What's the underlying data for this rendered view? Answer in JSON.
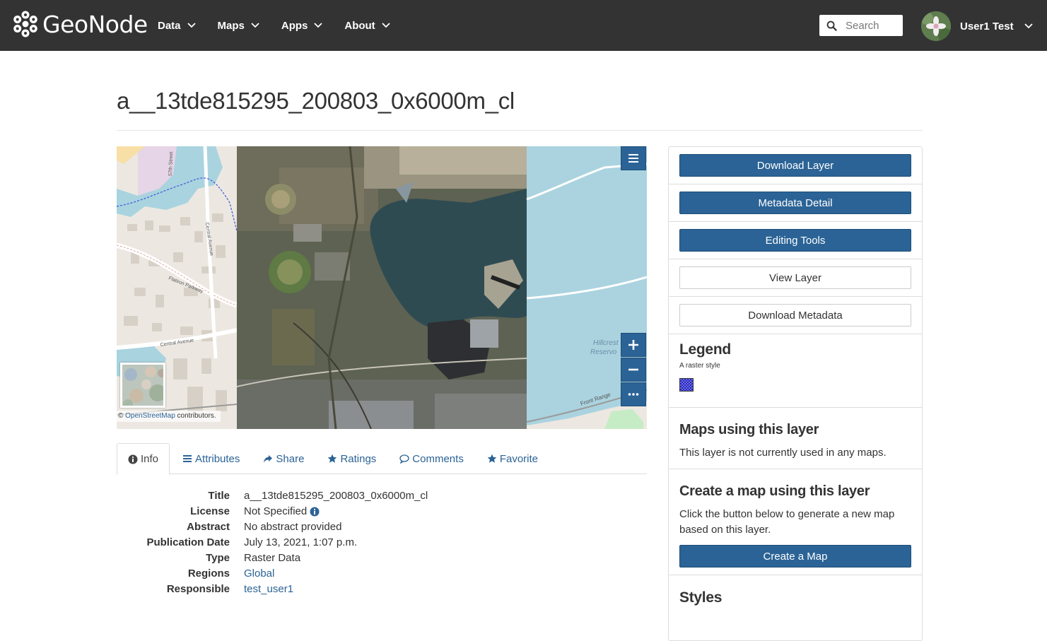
{
  "brand": {
    "name": "GeoNode"
  },
  "nav": {
    "items": [
      {
        "label": "Data"
      },
      {
        "label": "Maps"
      },
      {
        "label": "Apps"
      },
      {
        "label": "About"
      }
    ],
    "search_placeholder": "Search",
    "user_name": "User1 Test"
  },
  "page": {
    "title": "a__13tde815295_200803_0x6000m_cl"
  },
  "map": {
    "attribution_prefix": "© ",
    "attribution_link": "OpenStreetMap",
    "attribution_suffix": " contributors.",
    "street_labels": [
      "57th Street",
      "Central Avenue",
      "Flatiron Parkway",
      "Central Avenue",
      "Hillcrest",
      "Reservo",
      "Front Range"
    ]
  },
  "tabs": [
    {
      "label": "Info",
      "icon": "info-circle-icon",
      "active": true
    },
    {
      "label": "Attributes",
      "icon": "list-icon"
    },
    {
      "label": "Share",
      "icon": "share-icon"
    },
    {
      "label": "Ratings",
      "icon": "star-icon"
    },
    {
      "label": "Comments",
      "icon": "comment-icon"
    },
    {
      "label": "Favorite",
      "icon": "star-icon"
    }
  ],
  "info": {
    "rows": [
      {
        "label": "Title",
        "value": "a__13tde815295_200803_0x6000m_cl"
      },
      {
        "label": "License",
        "value": "Not Specified"
      },
      {
        "label": "Abstract",
        "value": "No abstract provided"
      },
      {
        "label": "Publication Date",
        "value": "July 13, 2021, 1:07 p.m."
      },
      {
        "label": "Type",
        "value": "Raster Data"
      },
      {
        "label": "Regions",
        "value": "Global"
      },
      {
        "label": "Responsible",
        "value": "test_user1"
      }
    ]
  },
  "sidebar": {
    "buttons": [
      {
        "label": "Download Layer",
        "style": "primary"
      },
      {
        "label": "Metadata Detail",
        "style": "primary"
      },
      {
        "label": "Editing Tools",
        "style": "primary"
      },
      {
        "label": "View Layer",
        "style": "default"
      },
      {
        "label": "Download Metadata",
        "style": "default"
      }
    ],
    "legend": {
      "title": "Legend",
      "subtitle": "A raster style"
    },
    "maps_using": {
      "title": "Maps using this layer",
      "text": "This layer is not currently used in any maps."
    },
    "create_map": {
      "title": "Create a map using this layer",
      "text": "Click the button below to generate a new map based on this layer.",
      "button": "Create a Map"
    },
    "styles": {
      "title": "Styles"
    }
  },
  "colors": {
    "navbar": "#333333",
    "primary": "#2b6396",
    "link": "#2b6396"
  }
}
